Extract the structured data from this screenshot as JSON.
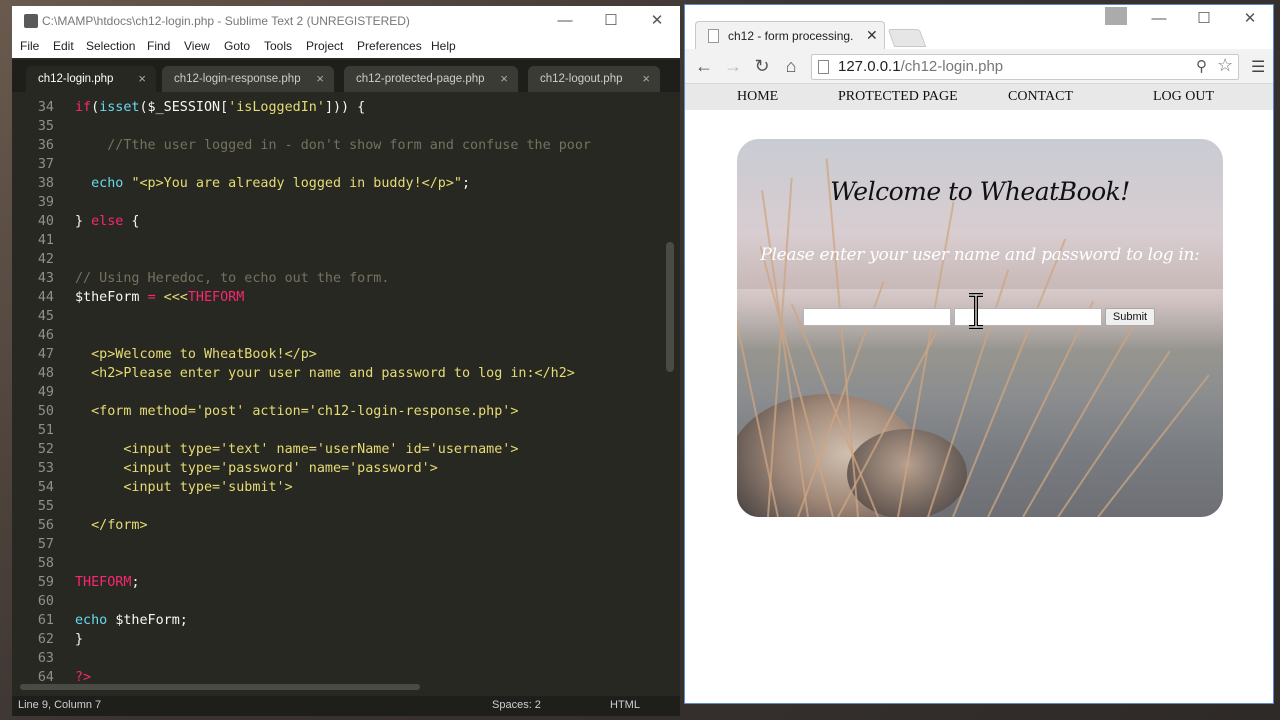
{
  "editor": {
    "title": "C:\\MAMP\\htdocs\\ch12-login.php - Sublime Text 2 (UNREGISTERED)",
    "menu": [
      "File",
      "Edit",
      "Selection",
      "Find",
      "View",
      "Goto",
      "Tools",
      "Project",
      "Preferences",
      "Help"
    ],
    "tabs": [
      "ch12-login.php",
      "ch12-login-response.php",
      "ch12-protected-page.php",
      "ch12-logout.php"
    ],
    "active_tab": "ch12-login.php",
    "lines": [
      {
        "n": "34",
        "segs": [
          {
            "t": "if",
            "c": "#f92672"
          },
          {
            "t": "(",
            "c": "#f8f8f2"
          },
          {
            "t": "isset",
            "c": "#66d9ef"
          },
          {
            "t": "($_SESSION[",
            "c": "#f8f8f2"
          },
          {
            "t": "'isLoggedIn'",
            "c": "#e6db74"
          },
          {
            "t": "])) {",
            "c": "#f8f8f2"
          }
        ]
      },
      {
        "n": "35",
        "segs": []
      },
      {
        "n": "36",
        "segs": [
          {
            "t": "    //Tthe user logged in - don't show form and confuse the poor ",
            "c": "#75715e"
          }
        ]
      },
      {
        "n": "37",
        "segs": []
      },
      {
        "n": "38",
        "segs": [
          {
            "t": "  echo ",
            "c": "#66d9ef"
          },
          {
            "t": "\"<p>You are already logged in buddy!</p>\"",
            "c": "#e6db74"
          },
          {
            "t": ";",
            "c": "#f8f8f2"
          }
        ]
      },
      {
        "n": "39",
        "segs": []
      },
      {
        "n": "40",
        "segs": [
          {
            "t": "} ",
            "c": "#f8f8f2"
          },
          {
            "t": "else",
            "c": "#f92672"
          },
          {
            "t": " {",
            "c": "#f8f8f2"
          }
        ]
      },
      {
        "n": "41",
        "segs": []
      },
      {
        "n": "42",
        "segs": []
      },
      {
        "n": "43",
        "segs": [
          {
            "t": "// Using Heredoc, to echo out the form.",
            "c": "#75715e"
          }
        ]
      },
      {
        "n": "44",
        "segs": [
          {
            "t": "$theForm ",
            "c": "#f8f8f2"
          },
          {
            "t": "=",
            "c": "#f92672"
          },
          {
            "t": " <<<",
            "c": "#e6db74"
          },
          {
            "t": "THEFORM",
            "c": "#f92672"
          }
        ]
      },
      {
        "n": "45",
        "segs": []
      },
      {
        "n": "46",
        "segs": []
      },
      {
        "n": "47",
        "segs": [
          {
            "t": "  <p>Welcome to WheatBook!</p>",
            "c": "#e6db74"
          }
        ]
      },
      {
        "n": "48",
        "segs": [
          {
            "t": "  <h2>Please enter your user name and password to log in:</h2>",
            "c": "#e6db74"
          }
        ]
      },
      {
        "n": "49",
        "segs": []
      },
      {
        "n": "50",
        "segs": [
          {
            "t": "  <form method='post' action='ch12-login-response.php'>",
            "c": "#e6db74"
          }
        ]
      },
      {
        "n": "51",
        "segs": []
      },
      {
        "n": "52",
        "segs": [
          {
            "t": "      <input type='text' name='userName' id='username'>",
            "c": "#e6db74"
          }
        ]
      },
      {
        "n": "53",
        "segs": [
          {
            "t": "      <input type='password' name='password'>",
            "c": "#e6db74"
          }
        ]
      },
      {
        "n": "54",
        "segs": [
          {
            "t": "      <input type='submit'>",
            "c": "#e6db74"
          }
        ]
      },
      {
        "n": "55",
        "segs": []
      },
      {
        "n": "56",
        "segs": [
          {
            "t": "  </form>",
            "c": "#e6db74"
          }
        ]
      },
      {
        "n": "57",
        "segs": []
      },
      {
        "n": "58",
        "segs": []
      },
      {
        "n": "59",
        "segs": [
          {
            "t": "THEFORM",
            "c": "#f92672"
          },
          {
            "t": ";",
            "c": "#f8f8f2"
          }
        ]
      },
      {
        "n": "60",
        "segs": []
      },
      {
        "n": "61",
        "segs": [
          {
            "t": "echo ",
            "c": "#66d9ef"
          },
          {
            "t": "$theForm;",
            "c": "#f8f8f2"
          }
        ]
      },
      {
        "n": "62",
        "segs": [
          {
            "t": "}",
            "c": "#f8f8f2"
          }
        ]
      },
      {
        "n": "63",
        "segs": []
      },
      {
        "n": "64",
        "segs": [
          {
            "t": "?>",
            "c": "#f92672"
          }
        ]
      }
    ],
    "status": {
      "position": "Line 9, Column 7",
      "spaces": "Spaces: 2",
      "syntax": "HTML"
    }
  },
  "browser": {
    "tab_title": "ch12 - form processing.",
    "url_host": "127.0.0.1",
    "url_path": "/ch12-login.php",
    "nav": [
      "HOME",
      "PROTECTED PAGE",
      "CONTACT",
      "LOG OUT"
    ],
    "heading": "Welcome to WheatBook!",
    "subheading": "Please enter your user name and password to log in:",
    "username_value": "",
    "password_value": "",
    "submit_label": "Submit"
  }
}
